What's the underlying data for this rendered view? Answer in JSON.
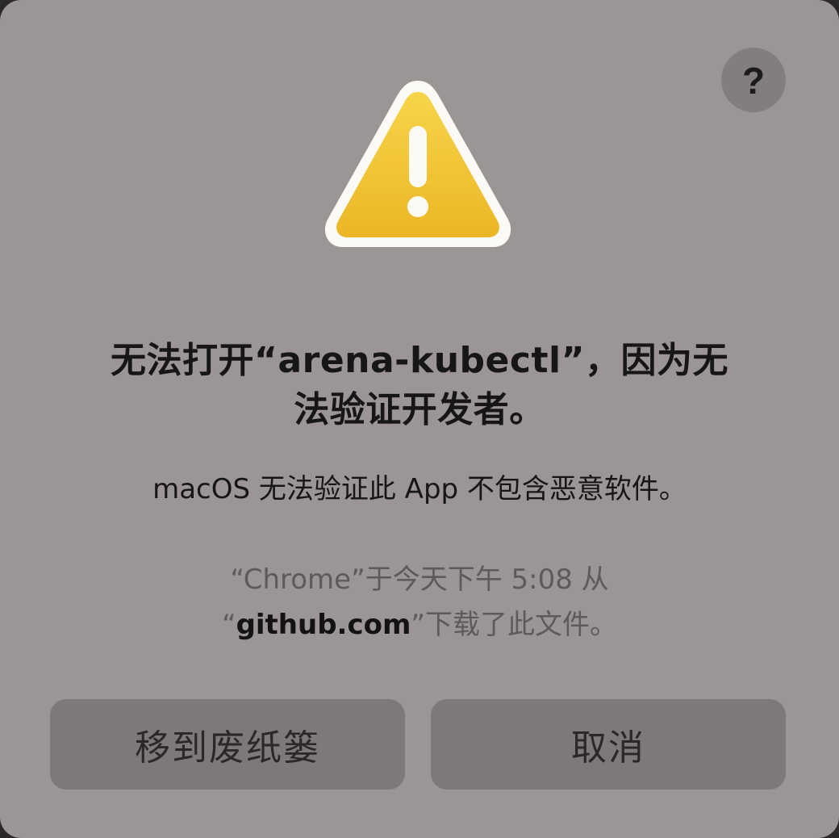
{
  "dialog": {
    "help_label": "?",
    "title_line1": "无法打开“arena-kubectl”，因为无",
    "title_line2": "法验证开发者。",
    "subtitle": "macOS 无法验证此 App 不包含恶意软件。",
    "source_line1": "“Chrome”于今天下午 5:08 从",
    "source_open_quote": "“",
    "source_domain": "github.com",
    "source_tail": "”下载了此文件。",
    "move_to_trash_label": "移到废纸篓",
    "cancel_label": "取消",
    "icon": "warning-triangle"
  },
  "colors": {
    "dialog_bg": "#9b9595",
    "button_bg": "#7e7878",
    "warning_yellow": "#f0c030",
    "warning_border": "#fdfdfb"
  }
}
